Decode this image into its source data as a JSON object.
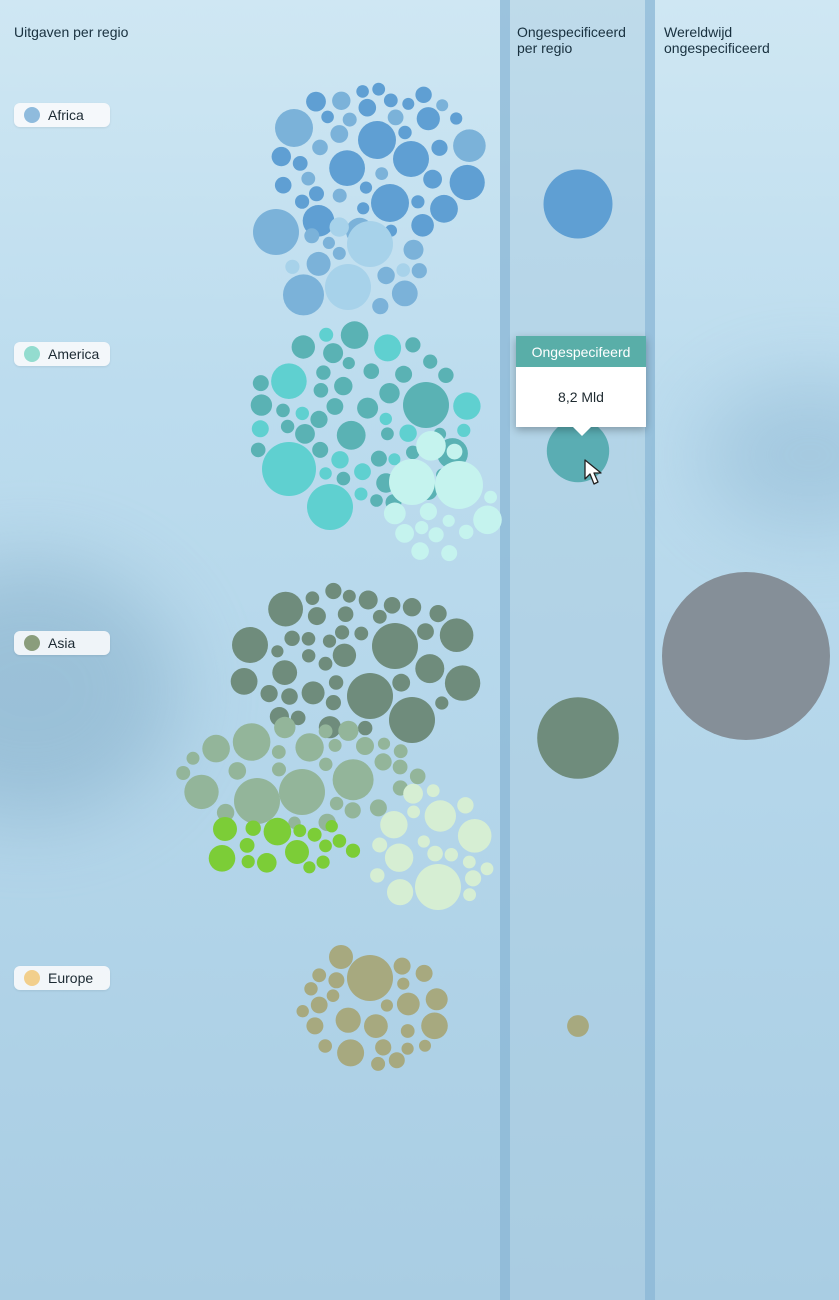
{
  "headers": {
    "per_region": "Uitgaven per regio",
    "unspec_line1": "Ongespecificeerd",
    "unspec_line2": "per regio",
    "world_line1": "Wereldwijd",
    "world_line2": "ongespecificeerd"
  },
  "legend": [
    {
      "label": "Africa",
      "color": "#8fbbdd"
    },
    {
      "label": "America",
      "color": "#93dccf"
    },
    {
      "label": "Asia",
      "color": "#8a9d7c"
    },
    {
      "label": "Europe",
      "color": "#f2cf8c"
    }
  ],
  "tooltip": {
    "title": "Ongespecifeerd",
    "value": "8,2 Mld"
  },
  "chart_data": {
    "type": "bubble",
    "series": [
      {
        "name": "Africa",
        "unspecified_value": 10
      },
      {
        "name": "America",
        "unspecified_value": 8.2
      },
      {
        "name": "Asia",
        "unspecified_value": 14
      },
      {
        "name": "Europe",
        "unspecified_value": 1
      }
    ],
    "worldwide_unspecified_value": 71,
    "colors": {
      "africa_dark": "#5f9fd3",
      "africa_mid": "#7bb2d9",
      "africa_light": "#a7d2ea",
      "america_dark": "#5ab2b4",
      "america_mid": "#5fd0d0",
      "america_light": "#c5f3ee",
      "asia_dark": "#6f8c7c",
      "asia_mid": "#93b59a",
      "asia_bright": "#7ccd37",
      "asia_pale": "#d6eed3",
      "europe": "#a7a97f",
      "world": "#858f98",
      "highlight": "#5aadb3"
    }
  }
}
